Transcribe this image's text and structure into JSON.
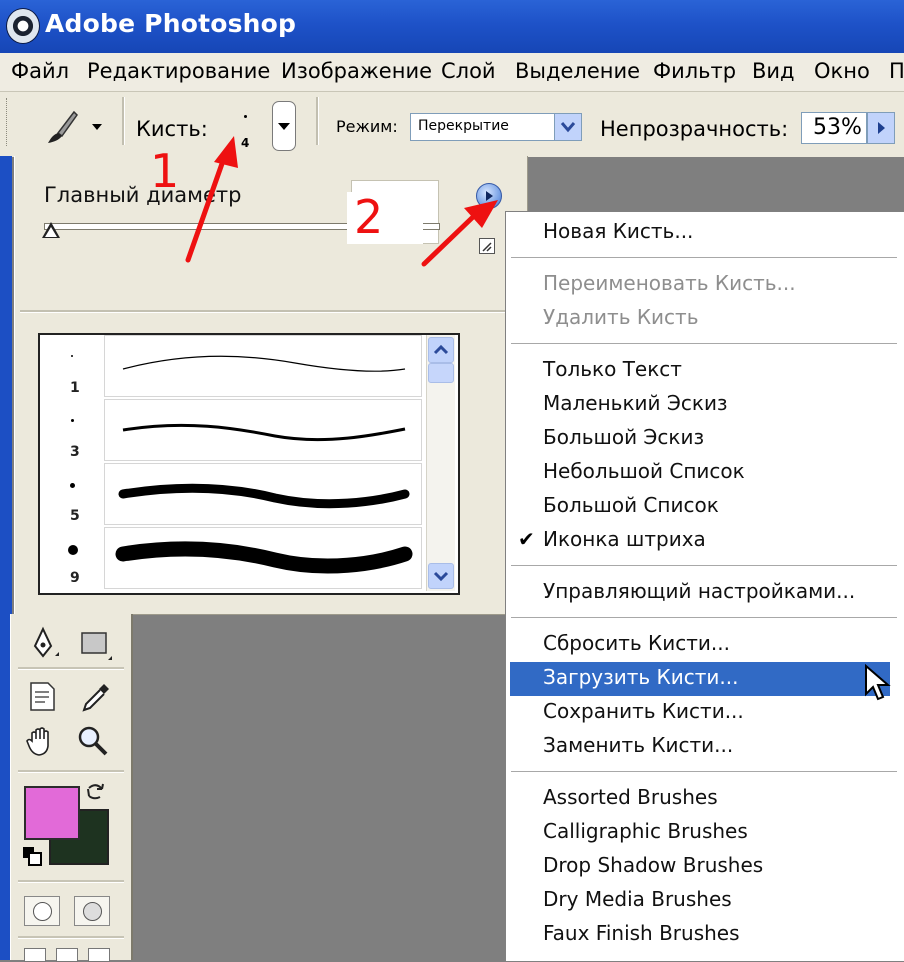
{
  "title_bar": {
    "title": "Adobe Photoshop"
  },
  "menu_bar": {
    "items": [
      "Файл",
      "Редактирование",
      "Изображение",
      "Слой",
      "Выделение",
      "Фильтр",
      "Вид",
      "Окно",
      "П"
    ]
  },
  "options_bar": {
    "brush_label": "Кисть:",
    "brush_size_value": "4",
    "mode_label": "Режим:",
    "mode_value": "Перекрытие",
    "opacity_label": "Непрозрачность:",
    "opacity_value": "53%"
  },
  "brush_panel": {
    "master_diameter_label": "Главный диаметр",
    "brush_sizes": [
      "1",
      "3",
      "5",
      "9"
    ]
  },
  "annotations": {
    "marker_1": "1",
    "marker_2": "2"
  },
  "context_menu": {
    "groups": [
      [
        {
          "label": "Новая Кисть...",
          "enabled": true
        }
      ],
      [
        {
          "label": "Переименовать Кисть...",
          "enabled": false
        },
        {
          "label": "Удалить Кисть",
          "enabled": false
        }
      ],
      [
        {
          "label": "Только Текст",
          "enabled": true
        },
        {
          "label": "Маленький Эскиз",
          "enabled": true
        },
        {
          "label": "Большой Эскиз",
          "enabled": true
        },
        {
          "label": "Небольшой Список",
          "enabled": true
        },
        {
          "label": "Большой Список",
          "enabled": true
        },
        {
          "label": "Иконка штриха",
          "enabled": true,
          "checked": true
        }
      ],
      [
        {
          "label": "Управляющий настройками...",
          "enabled": true
        }
      ],
      [
        {
          "label": "Сбросить Кисти...",
          "enabled": true
        },
        {
          "label": "Загрузить Кисти...",
          "enabled": true,
          "highlighted": true
        },
        {
          "label": "Сохранить Кисти...",
          "enabled": true
        },
        {
          "label": "Заменить Кисти...",
          "enabled": true
        }
      ],
      [
        {
          "label": "Assorted Brushes",
          "enabled": true
        },
        {
          "label": "Calligraphic Brushes",
          "enabled": true
        },
        {
          "label": "Drop Shadow Brushes",
          "enabled": true
        },
        {
          "label": "Dry Media Brushes",
          "enabled": true
        },
        {
          "label": "Faux Finish Brushes",
          "enabled": true
        }
      ]
    ]
  },
  "colors": {
    "title_bar": "#1e52c8",
    "highlight": "#316ac5",
    "foreground_swatch": "#e26ad8",
    "background_swatch": "#1e3320",
    "annotation": "#e11111"
  }
}
